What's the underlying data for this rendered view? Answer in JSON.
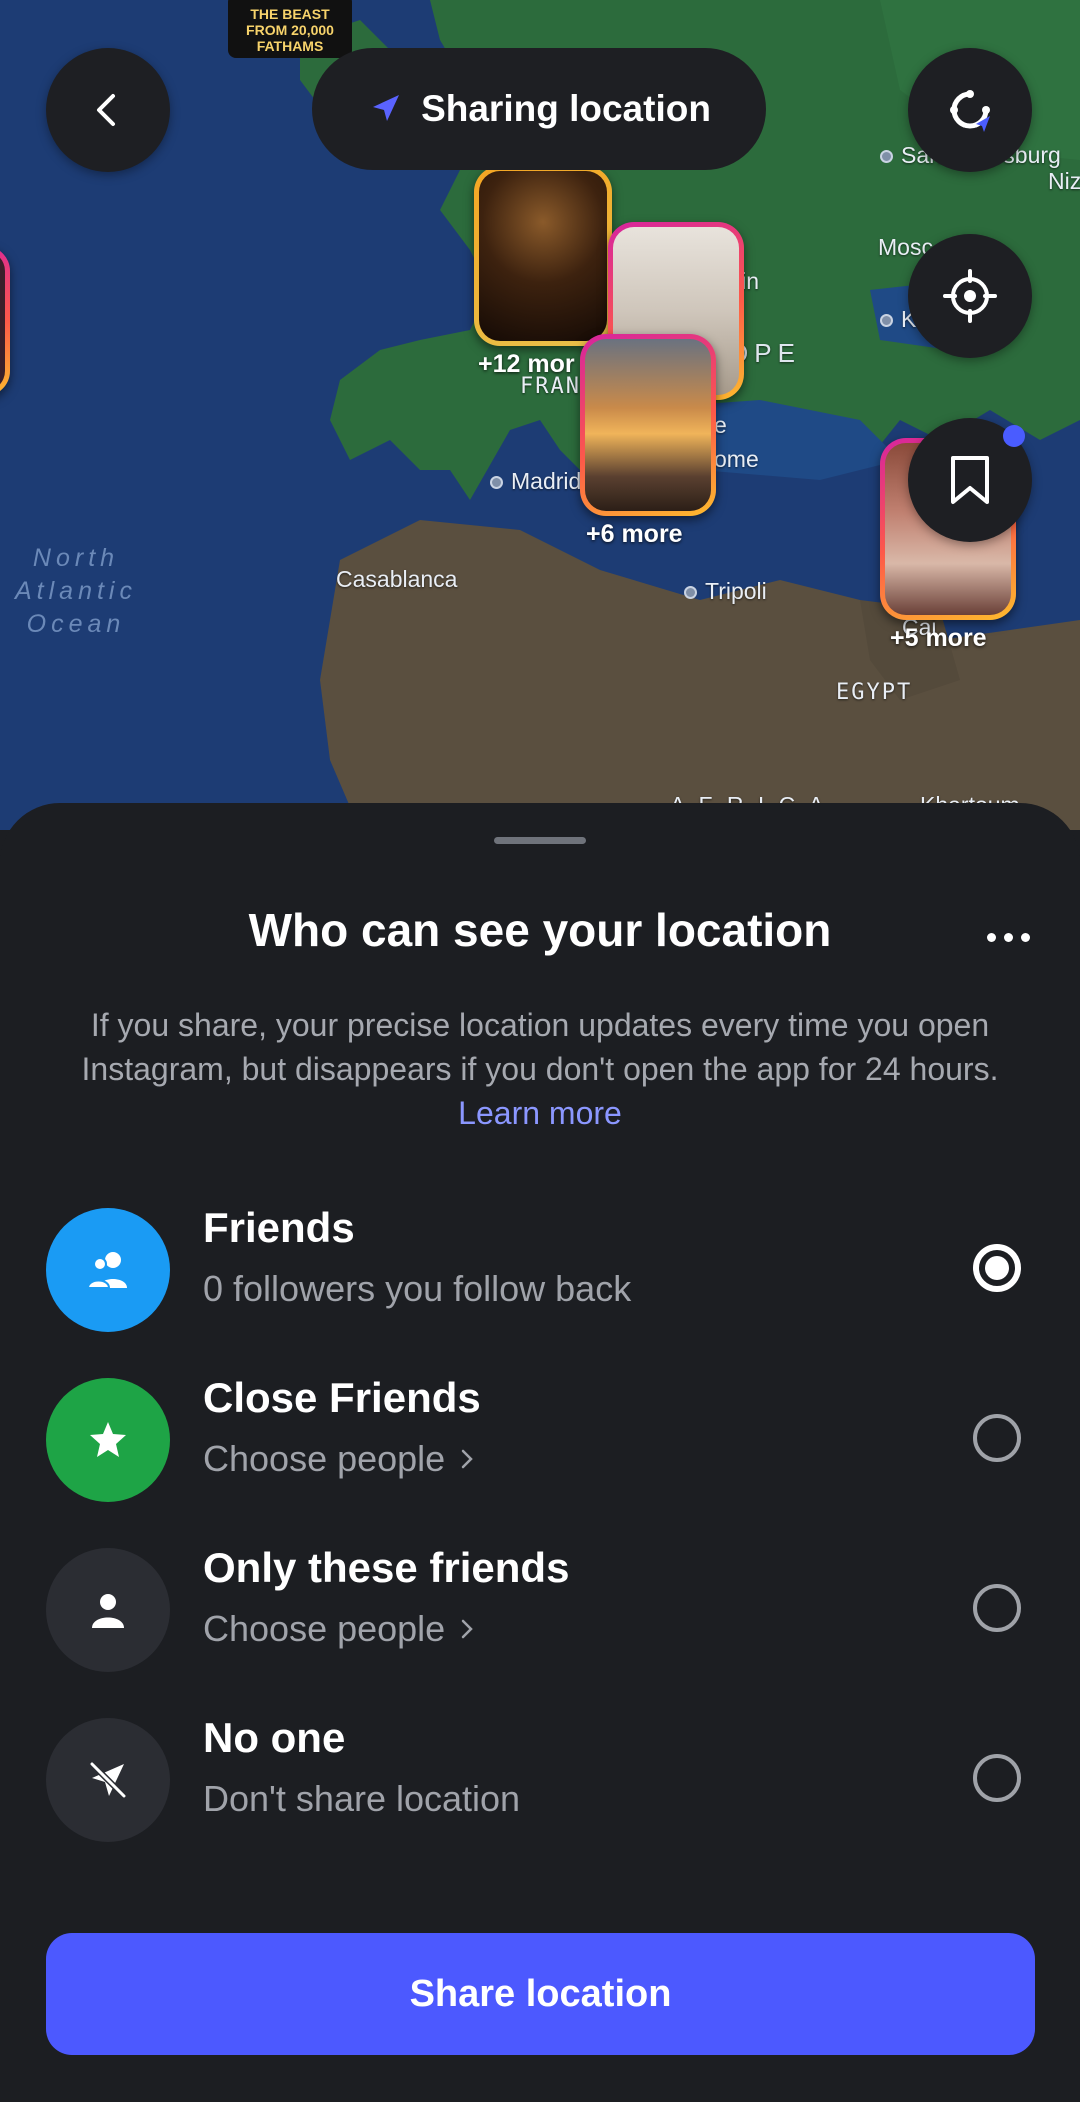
{
  "header": {
    "back_label": "Back",
    "pill_text": "Sharing location"
  },
  "map": {
    "poster_text": "THE BEAST FROM 20,000 FATHAMS",
    "labels": {
      "st_petersburg": "San Petersburg",
      "moscow": "Mosc",
      "kyiv": "K",
      "nizhny": "Niz No",
      "berlin": "lin",
      "europe": "OPE",
      "france": "FRAN",
      "madrid": "Madrid",
      "rome": "ome",
      "e": "e",
      "casablanca": "Casablanca",
      "tripoli": "Tripoli",
      "cairo": "Cai",
      "egypt": "EGYPT",
      "africa": "A F R I C A",
      "khartoum": "Khartoum",
      "ocean": "North Atlantic Ocean"
    },
    "clusters": {
      "first_more": "+12 mor",
      "second_more": "+6 more",
      "third_more": "+5 more"
    }
  },
  "sheet": {
    "title": "Who can see your location",
    "description": "If you share, your precise location updates every time you open Instagram, but disappears if you don't open the app for 24 hours. ",
    "learn_more": "Learn more",
    "options": [
      {
        "label": "Friends",
        "sub": "0 followers you follow back",
        "icon": "friends-icon",
        "color": "#1a9bf4",
        "selected": true
      },
      {
        "label": "Close Friends",
        "sub": "Choose people",
        "icon": "star-icon",
        "color": "#1ea446",
        "selected": false
      },
      {
        "label": "Only these friends",
        "sub": "Choose people",
        "icon": "person-icon",
        "color": "#2b2d33",
        "selected": false
      },
      {
        "label": "No one",
        "sub": "Don't share location",
        "icon": "location-off-icon",
        "color": "#2b2d33",
        "selected": false
      }
    ],
    "share_button": "Share location"
  }
}
